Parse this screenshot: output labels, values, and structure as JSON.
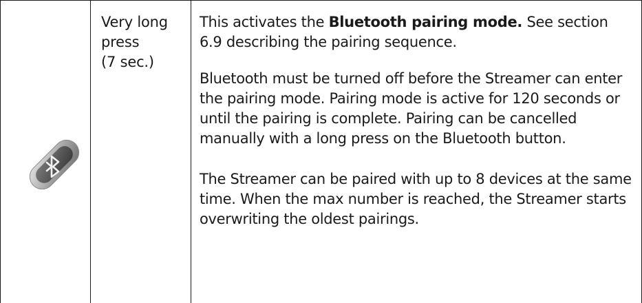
{
  "row": {
    "icon": "bluetooth-button-icon",
    "press_line1": "Very long",
    "press_line2": "press",
    "press_line3": "(7 sec.)",
    "desc_p1_pre": "This activates the ",
    "desc_p1_bold": "Bluetooth pairing mode.",
    "desc_p1_post": " See section 6.9 describing the pairing sequence.",
    "desc_p2": "Bluetooth must be turned off before the Streamer can enter the pairing mode. Pairing mode is active for 120 seconds or until the pairing is complete. Pairing can be cancelled manually with a long press on the Bluetooth button.",
    "desc_p3": "The Streamer can be paired with up to 8 devices at the same time. When the max number is reached, the Streamer starts overwriting the oldest pairings."
  }
}
